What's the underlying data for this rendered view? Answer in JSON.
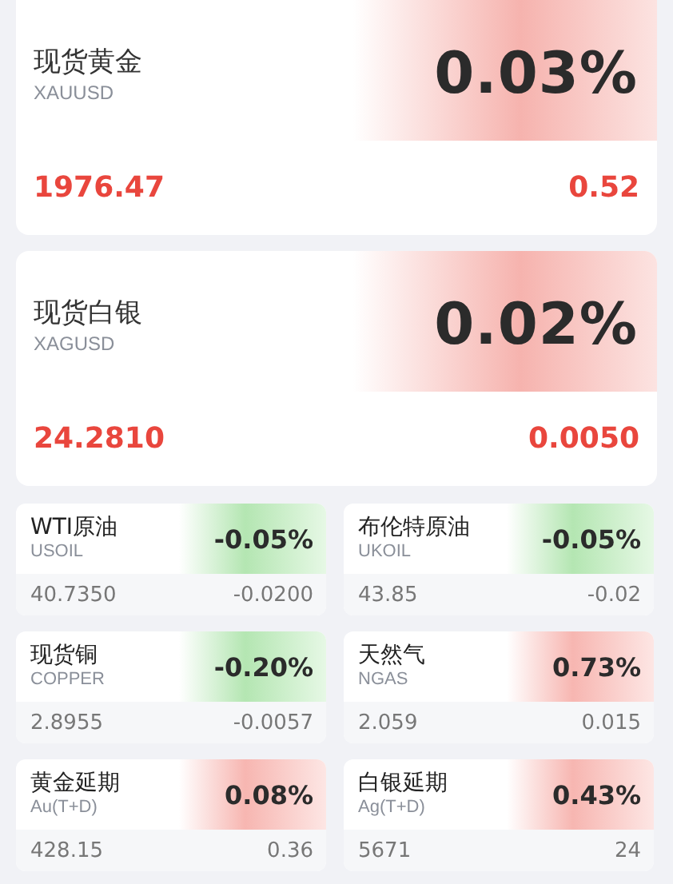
{
  "featured": [
    {
      "name": "现货黄金",
      "code": "XAUUSD",
      "change_pct": "0.03%",
      "kind": "up",
      "price": "1976.47",
      "change": "0.52"
    },
    {
      "name": "现货白银",
      "code": "XAGUSD",
      "change_pct": "0.02%",
      "kind": "up",
      "price": "24.2810",
      "change": "0.0050"
    }
  ],
  "quotes": [
    {
      "name": "WTI原油",
      "code": "USOIL",
      "change_pct": "-0.05%",
      "kind": "down",
      "price": "40.7350",
      "change": "-0.0200"
    },
    {
      "name": "布伦特原油",
      "code": "UKOIL",
      "change_pct": "-0.05%",
      "kind": "down",
      "price": "43.85",
      "change": "-0.02"
    },
    {
      "name": "现货铜",
      "code": "COPPER",
      "change_pct": "-0.20%",
      "kind": "down",
      "price": "2.8955",
      "change": "-0.0057"
    },
    {
      "name": "天然气",
      "code": "NGAS",
      "change_pct": "0.73%",
      "kind": "up",
      "price": "2.059",
      "change": "0.015"
    },
    {
      "name": "黄金延期",
      "code": "Au(T+D)",
      "change_pct": "0.08%",
      "kind": "up",
      "price": "428.15",
      "change": "0.36"
    },
    {
      "name": "白银延期",
      "code": "Ag(T+D)",
      "change_pct": "0.43%",
      "kind": "up",
      "price": "5671",
      "change": "24"
    }
  ]
}
